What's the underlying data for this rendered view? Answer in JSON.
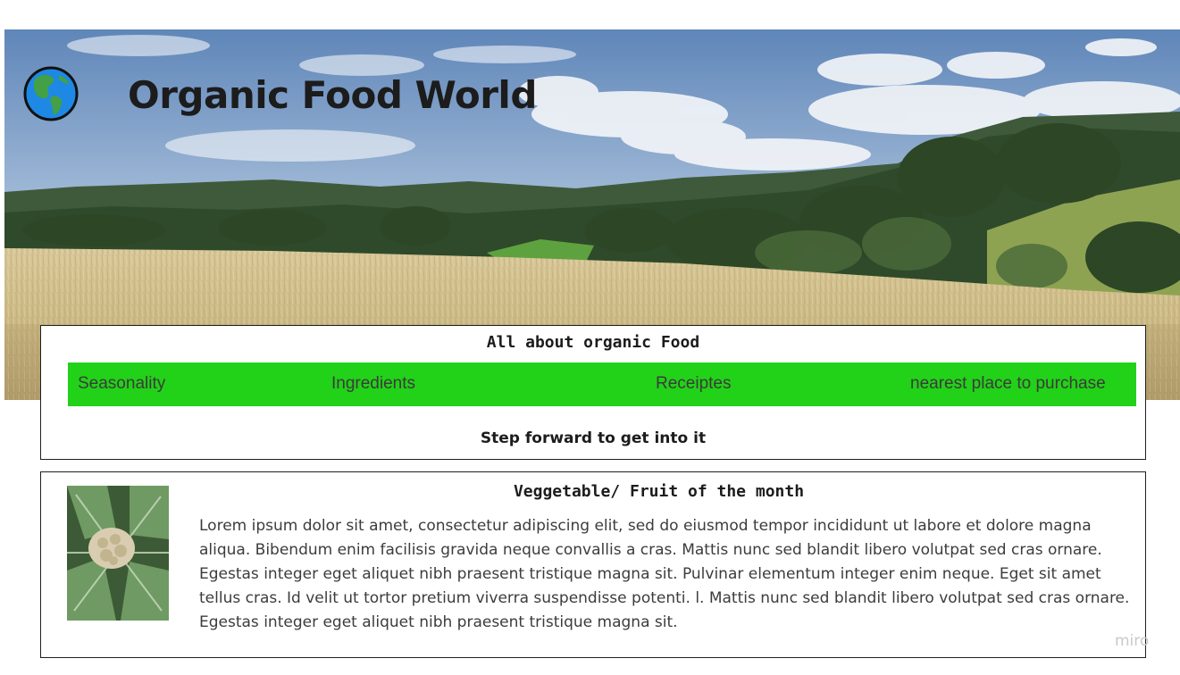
{
  "header": {
    "title": "Organic Food World",
    "logo_icon": "globe-americas-icon",
    "banner": "wheat-field-landscape"
  },
  "nav_card": {
    "heading": "All about organic Food",
    "items": [
      {
        "label": "Seasonality"
      },
      {
        "label": "Ingredients"
      },
      {
        "label": "Receiptes"
      },
      {
        "label": "nearest place to purchase"
      }
    ],
    "tagline": "Step forward to get into it"
  },
  "feature": {
    "title": "Veggetable/ Fruit of the month",
    "image": "cauliflower-photo",
    "text": "Lorem ipsum dolor sit amet, consectetur adipiscing elit, sed do eiusmod tempor incididunt ut labore et dolore magna aliqua. Bibendum enim facilisis gravida neque convallis a cras. Mattis nunc sed blandit libero volutpat sed cras ornare. Egestas integer eget aliquet nibh praesent tristique magna sit. Pulvinar elementum integer enim neque. Eget sit amet tellus cras. Id velit ut tortor pretium viverra suspendisse potenti. l. Mattis nunc sed blandit libero volutpat sed cras ornare. Egestas integer eget aliquet nibh praesent tristique magna sit."
  },
  "watermark": "miro",
  "colors": {
    "nav_bar": "#22d218",
    "border": "#1f1f1f",
    "title_text": "#1c1c1c",
    "body_text": "#3c3c3c",
    "globe_ocean": "#1e88e5",
    "globe_land": "#43a047"
  }
}
